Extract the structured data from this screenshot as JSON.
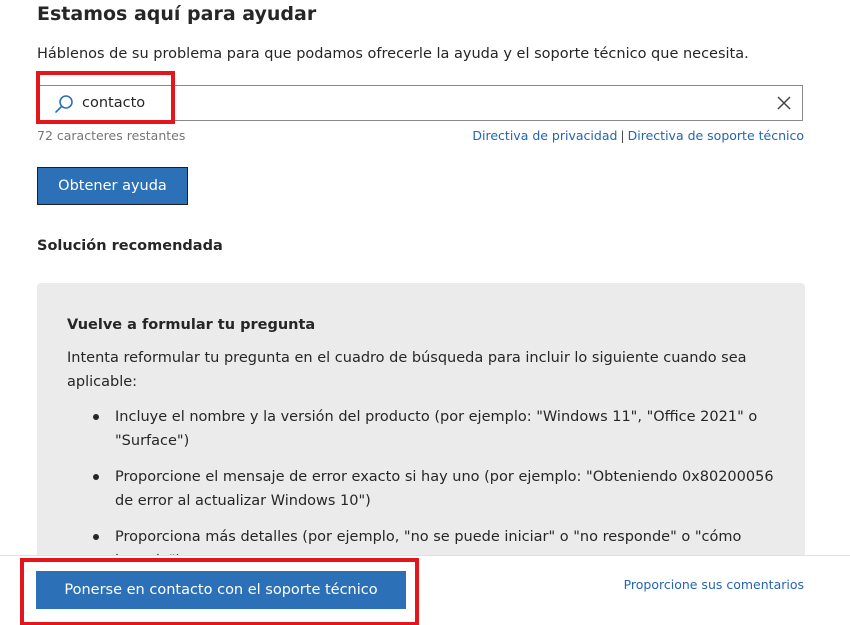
{
  "header": {
    "title": "Estamos aquí para ayudar",
    "subtitle": "Háblenos de su problema para que podamos ofrecerle la ayuda y el soporte técnico que necesita."
  },
  "search": {
    "value": "contacto",
    "icon": "search-icon",
    "clear_icon": "close-icon",
    "chars_remaining": "72 caracteres restantes"
  },
  "policy": {
    "privacy_label": "Directiva de privacidad",
    "separator": "|",
    "support_label": "Directiva de soporte técnico"
  },
  "actions": {
    "get_help_label": "Obtener ayuda"
  },
  "recommended": {
    "title": "Solución recomendada",
    "card": {
      "heading": "Vuelve a formular tu pregunta",
      "intro": "Intenta reformular tu pregunta en el cuadro de búsqueda para incluir lo siguiente cuando sea aplicable:",
      "items": [
        "Incluye el nombre y la versión del producto (por ejemplo: \"Windows 11\", \"Office 2021\" o \"Surface\")",
        "Proporcione el mensaje de error exacto si hay uno (por ejemplo: \"Obteniendo 0x80200056 de error al actualizar Windows 10\")",
        "Proporciona más detalles (por ejemplo, \"no se puede iniciar\" o \"no responde\" o \"cómo hacerlo\")"
      ]
    }
  },
  "footer": {
    "contact_label": "Ponerse en contacto con el soporte técnico",
    "feedback_label": "Proporcione sus comentarios"
  },
  "colors": {
    "accent": "#2c71b8",
    "link": "#2465b3",
    "highlight": "#e3161c",
    "card_bg": "#ebebeb"
  }
}
